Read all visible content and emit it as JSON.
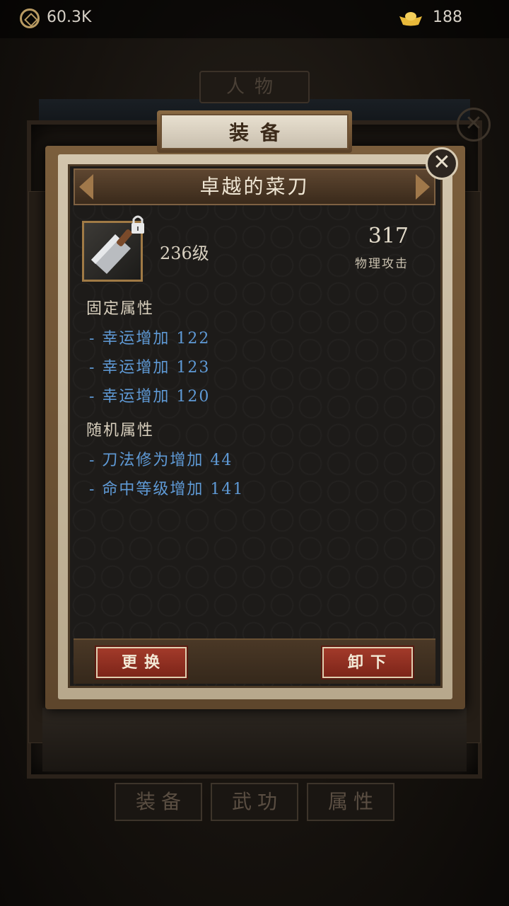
{
  "topbar": {
    "coins": "60.3K",
    "ingots": "188"
  },
  "background": {
    "character_tab": "人物",
    "bottom_tabs": [
      "装备",
      "武功",
      "属性"
    ]
  },
  "equip_tab": "装备",
  "item": {
    "name": "卓越的菜刀",
    "level": "236级",
    "stat_value": "317",
    "stat_label": "物理攻击",
    "locked": true
  },
  "sections": {
    "fixed_title": "固定属性",
    "fixed_attrs": [
      "- 幸运增加 122",
      "- 幸运增加 123",
      "- 幸运增加 120"
    ],
    "random_title": "随机属性",
    "random_attrs": [
      "- 刀法修为增加 44",
      "- 命中等级增加 141"
    ]
  },
  "buttons": {
    "replace": "更换",
    "unequip": "卸下"
  },
  "colors": {
    "attr_blue": "#5f9ad6",
    "button_red": "#a23a2a",
    "frame_brown": "#7b5e3c"
  }
}
